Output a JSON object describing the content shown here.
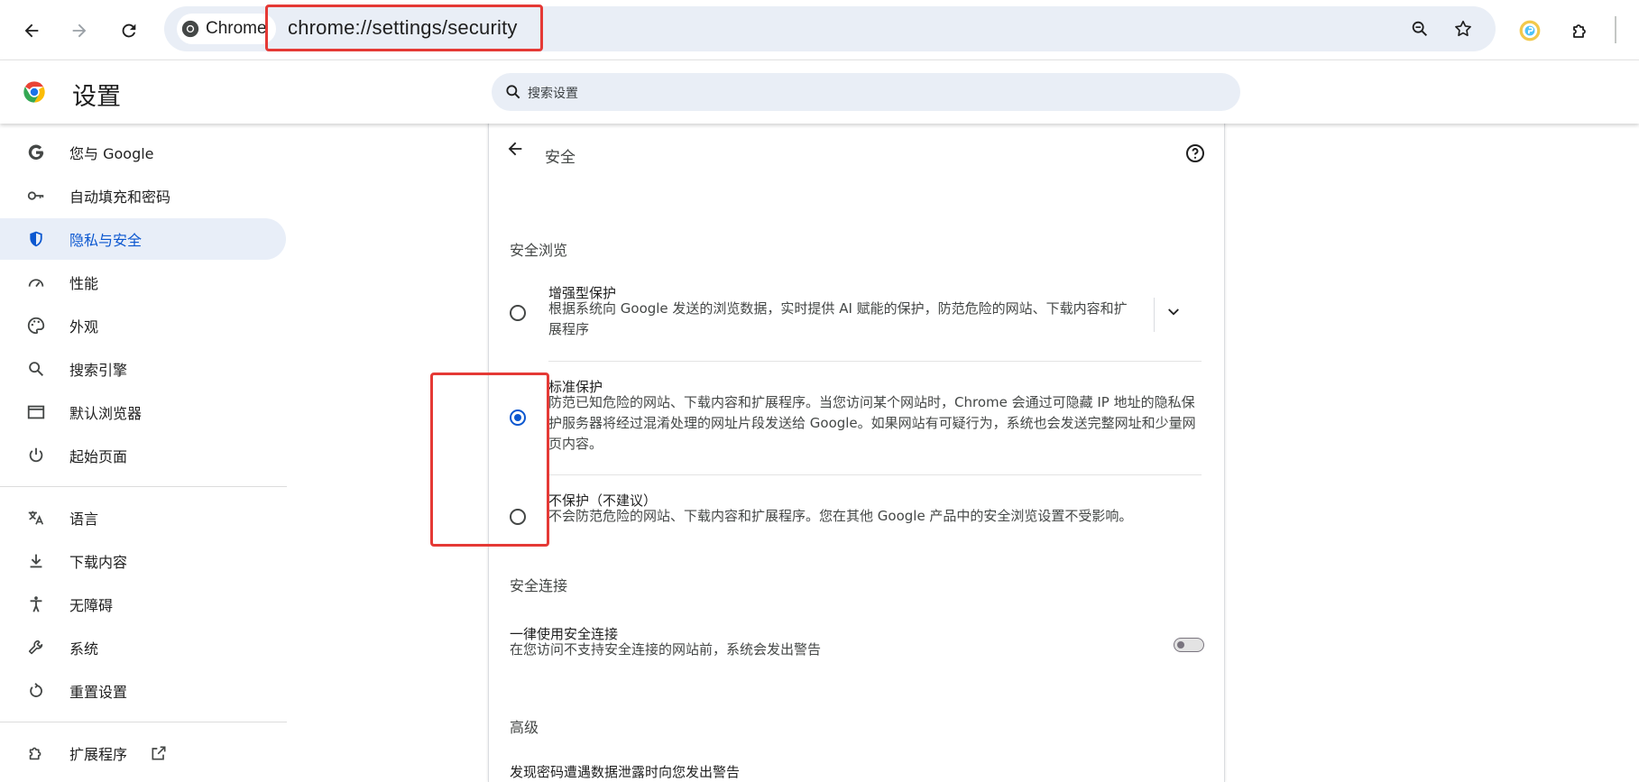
{
  "browser": {
    "site_chip_label": "Chrome",
    "url": "chrome://settings/security"
  },
  "header": {
    "title": "设置",
    "search_placeholder": "搜索设置"
  },
  "sidebar": {
    "items": [
      {
        "label": "您与 Google",
        "icon": "google-g-icon"
      },
      {
        "label": "自动填充和密码",
        "icon": "key-icon"
      },
      {
        "label": "隐私与安全",
        "icon": "shield-icon",
        "active": true
      },
      {
        "label": "性能",
        "icon": "speedometer-icon"
      },
      {
        "label": "外观",
        "icon": "palette-icon"
      },
      {
        "label": "搜索引擎",
        "icon": "search-icon"
      },
      {
        "label": "默认浏览器",
        "icon": "browser-window-icon"
      },
      {
        "label": "起始页面",
        "icon": "power-icon"
      },
      {
        "label": "语言",
        "icon": "translate-icon"
      },
      {
        "label": "下载内容",
        "icon": "download-icon"
      },
      {
        "label": "无障碍",
        "icon": "accessibility-icon"
      },
      {
        "label": "系统",
        "icon": "wrench-icon"
      },
      {
        "label": "重置设置",
        "icon": "reset-icon"
      },
      {
        "label": "扩展程序",
        "icon": "extension-icon"
      }
    ]
  },
  "page": {
    "title": "安全",
    "safe_browsing_heading": "安全浏览",
    "options": [
      {
        "title": "增强型保护",
        "desc": "根据系统向 Google 发送的浏览数据，实时提供 AI 赋能的保护，防范危险的网站、下载内容和扩展程序",
        "selected": false
      },
      {
        "title": "标准保护",
        "desc": "防范已知危险的网站、下载内容和扩展程序。当您访问某个网站时，Chrome 会通过可隐藏 IP 地址的隐私保护服务器将经过混淆处理的网址片段发送给 Google。如果网站有可疑行为，系统也会发送完整网址和少量网页内容。",
        "selected": true
      },
      {
        "title": "不保护（不建议）",
        "desc": "不会防范危险的网站、下载内容和扩展程序。您在其他 Google 产品中的安全浏览设置不受影响。",
        "selected": false
      }
    ],
    "secure_connections_heading": "安全连接",
    "https_title": "一律使用安全连接",
    "https_desc": "在您访问不支持安全连接的网站前，系统会发出警告",
    "https_enabled": false,
    "advanced_heading": "高级",
    "leak_warning_title": "发现密码遭遇数据泄露时向您发出警告"
  },
  "colors": {
    "accent": "#0b57d0",
    "active_nav_bg": "#e8eef8",
    "highlight_box": "#e53935"
  }
}
